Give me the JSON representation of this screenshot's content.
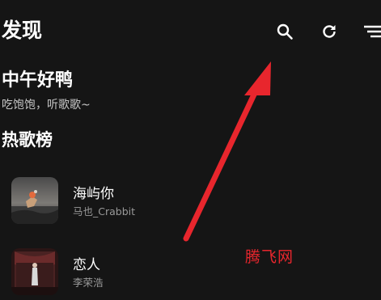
{
  "header": {
    "title": "发现",
    "icons": [
      "search-icon",
      "refresh-icon",
      "filter-sort-icon"
    ]
  },
  "greeting": {
    "title": "中午好鸭",
    "subtitle": "吃饱饱，听歌歌~"
  },
  "section": {
    "title": "热歌榜"
  },
  "songs": [
    {
      "title": "海屿你",
      "artist": "马也_Crabbit"
    },
    {
      "title": "恋人",
      "artist": "李荣浩"
    }
  ],
  "watermark": "腾飞网",
  "colors": {
    "background": "#151515",
    "annotation_red": "#e8262d",
    "secondary_text": "#9a9a9a"
  }
}
